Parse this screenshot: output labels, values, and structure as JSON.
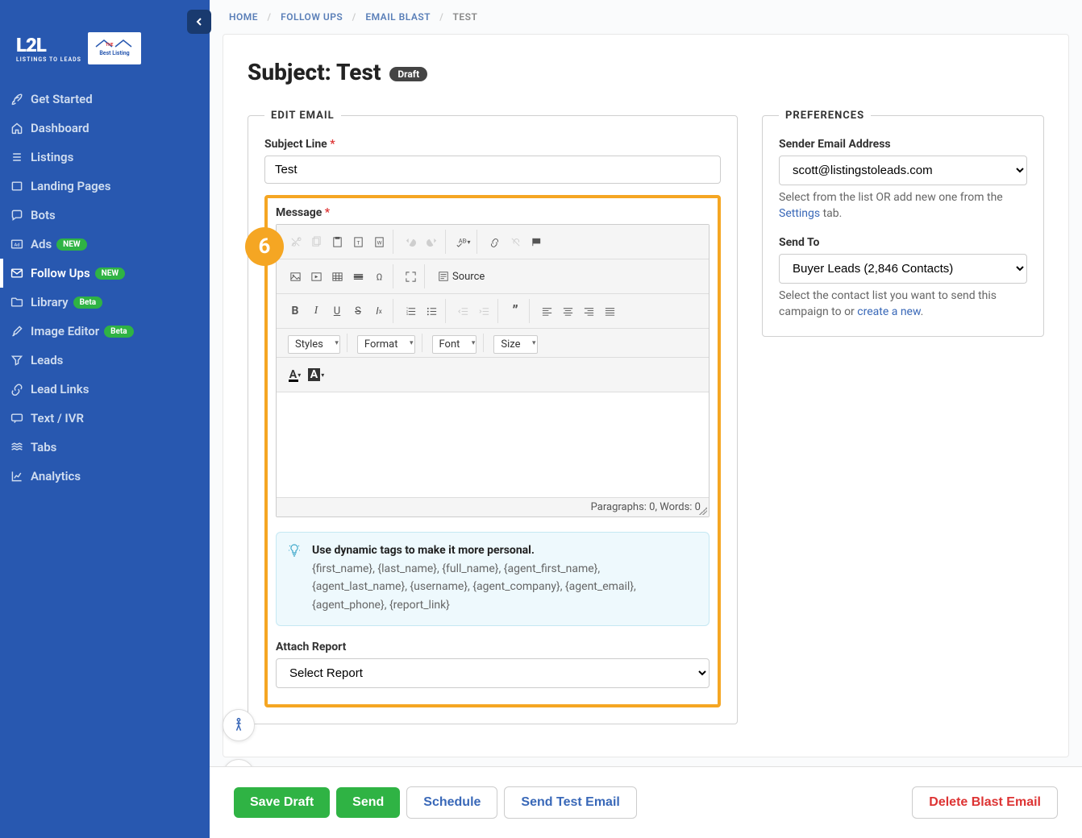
{
  "breadcrumb": {
    "home": "HOME",
    "followups": "FOLLOW UPS",
    "emailblast": "EMAIL BLAST",
    "current": "TEST"
  },
  "page": {
    "title_prefix": "Subject: ",
    "title_value": "Test",
    "draft_badge": "Draft"
  },
  "sidebar": {
    "items": [
      {
        "icon": "rocket",
        "label": "Get Started"
      },
      {
        "icon": "home",
        "label": "Dashboard"
      },
      {
        "icon": "list",
        "label": "Listings"
      },
      {
        "icon": "square",
        "label": "Landing Pages"
      },
      {
        "icon": "chat",
        "label": "Bots"
      },
      {
        "icon": "ad",
        "label": "Ads",
        "badge": "NEW",
        "badge_class": "new"
      },
      {
        "icon": "mail",
        "label": "Follow Ups",
        "badge": "NEW",
        "badge_class": "new",
        "active": true
      },
      {
        "icon": "folder",
        "label": "Library",
        "badge": "Beta",
        "badge_class": "beta"
      },
      {
        "icon": "brush",
        "label": "Image Editor",
        "badge": "Beta",
        "badge_class": "beta"
      },
      {
        "icon": "funnel",
        "label": "Leads"
      },
      {
        "icon": "link",
        "label": "Lead Links"
      },
      {
        "icon": "msg",
        "label": "Text / IVR"
      },
      {
        "icon": "tabs",
        "label": "Tabs"
      },
      {
        "icon": "chart",
        "label": "Analytics"
      }
    ]
  },
  "edit_email": {
    "legend": "EDIT EMAIL",
    "subject_label": "Subject Line",
    "subject_value": "Test",
    "message_label": "Message",
    "attach_label": "Attach Report",
    "attach_value": "Select Report",
    "step_number": "6"
  },
  "editor": {
    "styles": "Styles",
    "format": "Format",
    "font": "Font",
    "size": "Size",
    "source": "Source",
    "statusbar": "Paragraphs: 0, Words: 0"
  },
  "tip": {
    "title": "Use dynamic tags to make it more personal.",
    "tags": "{first_name}, {last_name}, {full_name}, {agent_first_name}, {agent_last_name}, {username}, {agent_company}, {agent_email}, {agent_phone}, {report_link}"
  },
  "preferences": {
    "legend": "PREFERENCES",
    "sender_label": "Sender Email Address",
    "sender_value": "scott@listingstoleads.com",
    "sender_help_pre": "Select from the list OR add new one from the ",
    "sender_help_link": "Settings",
    "sender_help_post": " tab.",
    "sendto_label": "Send To",
    "sendto_value": "Buyer Leads (2,846 Contacts)",
    "sendto_help_pre": "Select the contact list you want to send this campaign to or ",
    "sendto_help_link": "create a new",
    "sendto_help_post": "."
  },
  "footer": {
    "save_draft": "Save Draft",
    "send": "Send",
    "schedule": "Schedule",
    "send_test": "Send Test Email",
    "delete": "Delete Blast Email"
  }
}
